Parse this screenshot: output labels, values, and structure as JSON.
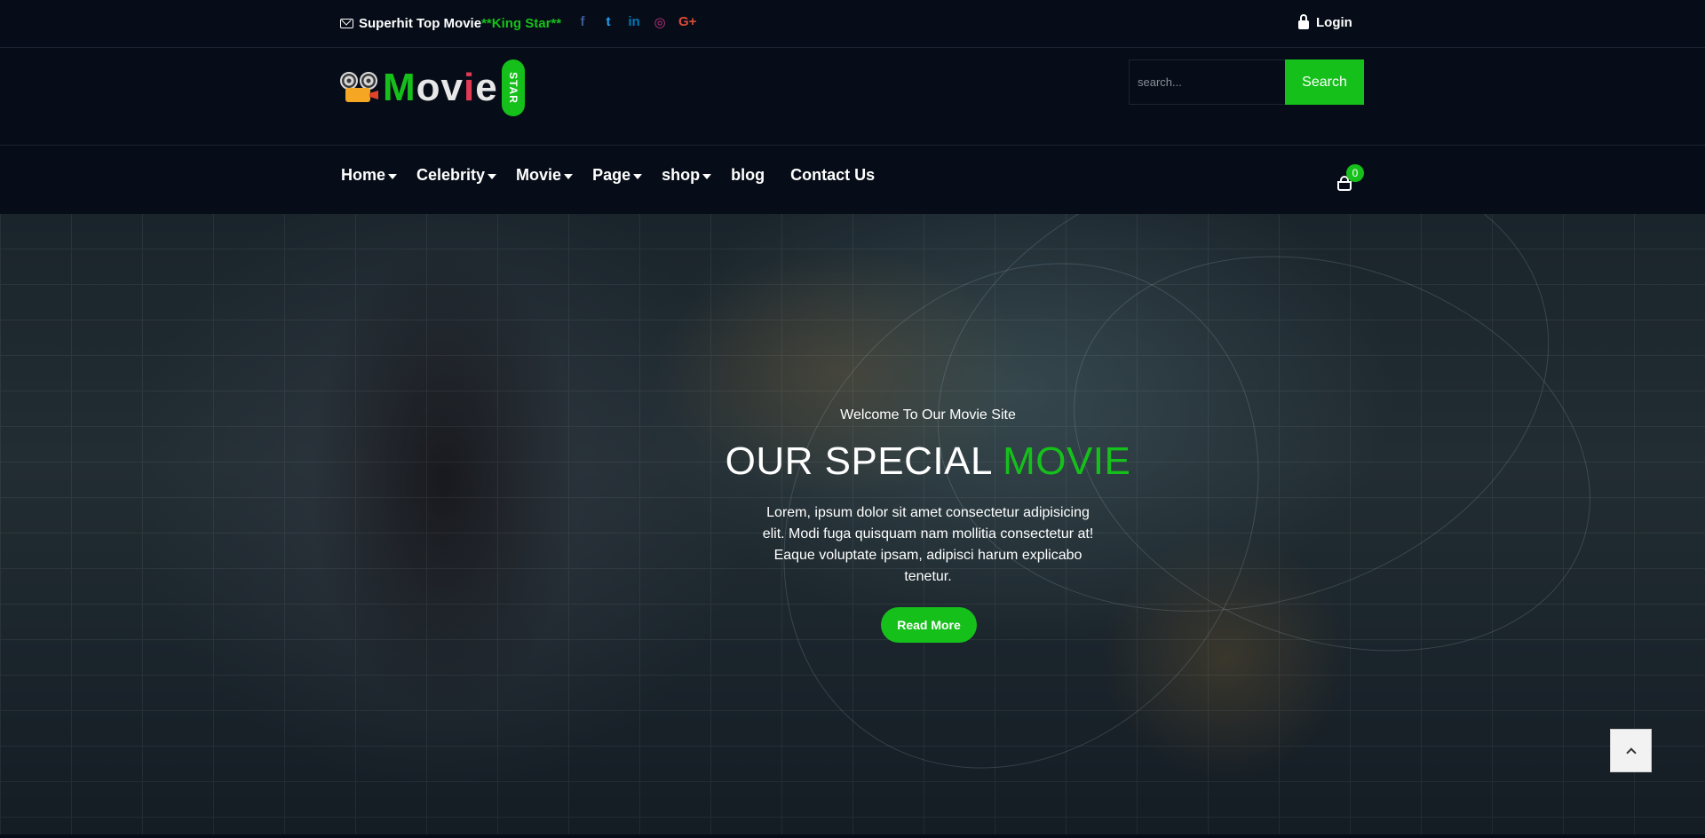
{
  "topbar": {
    "tagline_main": "Superhit Top Movie",
    "tagline_highlight": "**King Star**",
    "socials": [
      {
        "icon": "facebook-icon",
        "glyph": "f",
        "color": "#3b5998"
      },
      {
        "icon": "twitter-icon",
        "glyph": "t",
        "color": "#1da1f2"
      },
      {
        "icon": "linkedin-icon",
        "glyph": "in",
        "color": "#0077b5"
      },
      {
        "icon": "instagram-icon",
        "glyph": "◎",
        "color": "#c13584"
      },
      {
        "icon": "google-plus-icon",
        "glyph": "G+",
        "color": "#dd4b39"
      }
    ],
    "login_label": "Login"
  },
  "logo": {
    "letters": [
      "M",
      "o",
      "v",
      "i",
      "e"
    ],
    "badge": "STAR"
  },
  "search": {
    "placeholder": "search...",
    "button_label": "Search"
  },
  "nav": {
    "items": [
      {
        "label": "Home",
        "dropdown": true
      },
      {
        "label": "Celebrity",
        "dropdown": true
      },
      {
        "label": "Movie",
        "dropdown": true
      },
      {
        "label": "Page",
        "dropdown": true
      },
      {
        "label": "shop",
        "dropdown": true
      },
      {
        "label": "blog",
        "dropdown": false
      },
      {
        "label": "Contact Us",
        "dropdown": false
      }
    ],
    "cart_count": "0"
  },
  "hero": {
    "welcome": "Welcome To Our Movie Site",
    "headline_white": "OUR SPECIAL",
    "headline_green": "MOVIE",
    "description": "Lorem, ipsum dolor sit amet consectetur adipisicing elit. Modi fuga quisquam nam mollitia consectetur at! Eaque voluptate ipsam, adipisci harum explicabo tenetur.",
    "button_label": "Read More"
  },
  "colors": {
    "accent": "#16c01b",
    "background": "#070d18"
  }
}
